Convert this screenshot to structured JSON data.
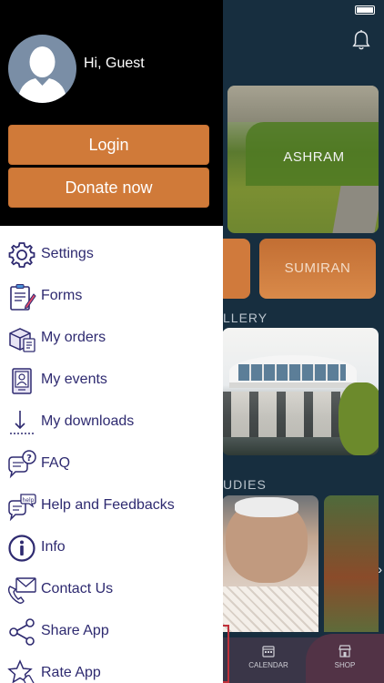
{
  "drawer": {
    "greeting": "Hi, Guest",
    "login_label": "Login",
    "donate_label": "Donate now",
    "menu": [
      {
        "label": "Settings",
        "icon": "gear-icon"
      },
      {
        "label": "Forms",
        "icon": "forms-icon"
      },
      {
        "label": "My orders",
        "icon": "orders-icon"
      },
      {
        "label": "My events",
        "icon": "events-icon"
      },
      {
        "label": "My downloads",
        "icon": "download-icon"
      },
      {
        "label": "FAQ",
        "icon": "faq-icon"
      },
      {
        "label": "Help and Feedbacks",
        "icon": "help-icon"
      },
      {
        "label": "Info",
        "icon": "info-icon"
      },
      {
        "label": "Contact Us",
        "icon": "contact-icon"
      },
      {
        "label": "Share App",
        "icon": "share-icon"
      },
      {
        "label": "Rate App",
        "icon": "rate-icon"
      }
    ]
  },
  "background": {
    "ashram_label": "ASHRAM",
    "sumiran_label": "SUMIRAN",
    "gallery_heading": "LLERY",
    "studies_heading": "UDIES",
    "nav_calendar": "CALENDAR",
    "nav_shop": "SHOP"
  },
  "colors": {
    "accent_orange": "#d07a39",
    "menu_text": "#2e2a70",
    "app_background": "#172e3f"
  }
}
